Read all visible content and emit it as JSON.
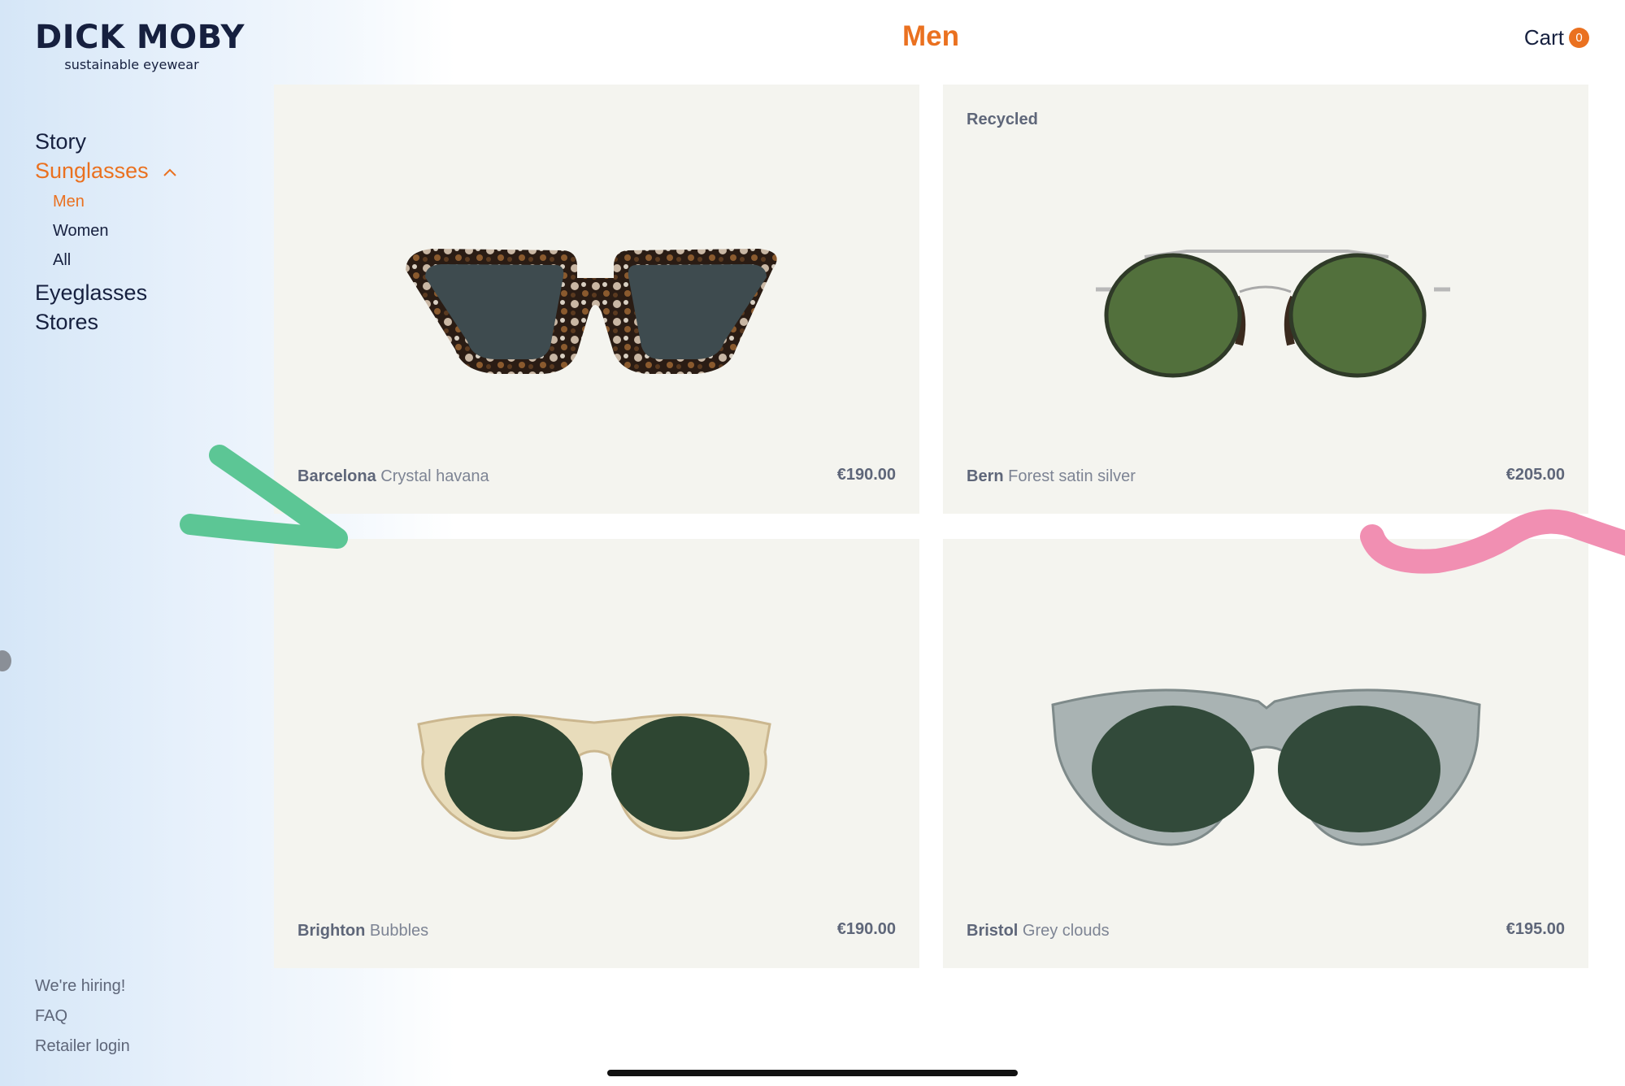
{
  "brand": {
    "name": "DICK MOBY",
    "tagline": "sustainable eyewear"
  },
  "page_title": "Men",
  "cart": {
    "label": "Cart",
    "count": "0"
  },
  "nav": {
    "story": "Story",
    "sunglasses": "Sunglasses",
    "sub": {
      "men": "Men",
      "women": "Women",
      "all": "All"
    },
    "eyeglasses": "Eyeglasses",
    "stores": "Stores"
  },
  "footer": {
    "hiring": "We're hiring!",
    "faq": "FAQ",
    "retailer": "Retailer login"
  },
  "products": [
    {
      "model": "Barcelona",
      "colorway": "Crystal havana",
      "price": "€190.00",
      "tag": ""
    },
    {
      "model": "Bern",
      "colorway": "Forest satin silver",
      "price": "€205.00",
      "tag": "Recycled"
    },
    {
      "model": "Brighton",
      "colorway": "Bubbles",
      "price": "€190.00",
      "tag": ""
    },
    {
      "model": "Bristol",
      "colorway": "Grey clouds",
      "price": "€195.00",
      "tag": ""
    }
  ],
  "colors": {
    "accent": "#ea7120",
    "navy": "#16203f",
    "card_bg": "#f4f4ef",
    "green_stroke": "#5cc695",
    "pink_stroke": "#f18fb2"
  },
  "icons": {
    "sunglasses_toggle": "chevron-up-icon"
  }
}
